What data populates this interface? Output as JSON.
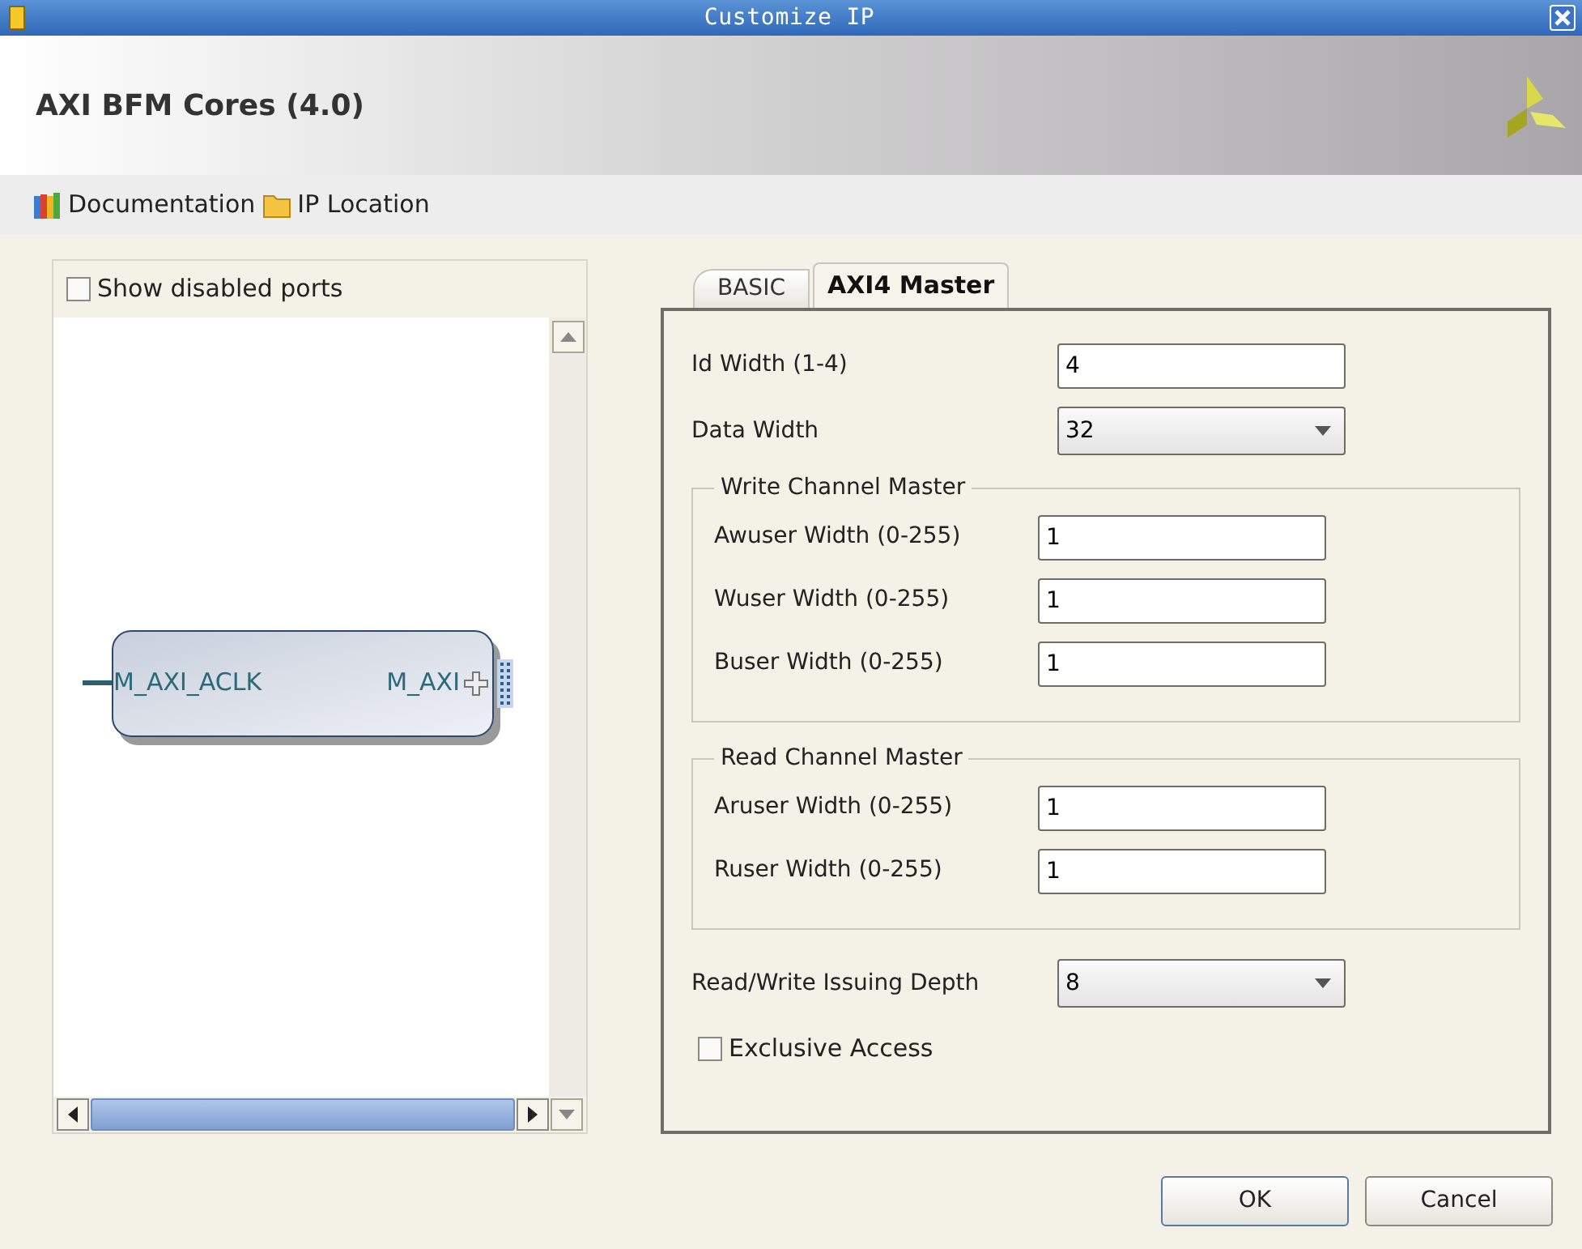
{
  "window": {
    "title": "Customize IP"
  },
  "header": {
    "title": "AXI BFM Cores (4.0)"
  },
  "toolbar": [
    {
      "kind": "books",
      "label": "Documentation"
    },
    {
      "kind": "folder",
      "label": "IP Location"
    }
  ],
  "ports_panel": {
    "show_disabled": {
      "label": "Show disabled ports",
      "checked": false
    },
    "block": {
      "left_port": "M_AXI_ACLK",
      "right_port": "M_AXI"
    }
  },
  "tabs": [
    {
      "label": "BASIC",
      "selected": false
    },
    {
      "label": "AXI4 Master",
      "selected": true
    }
  ],
  "fields": [
    {
      "kind": "text",
      "label": "Id Width (1-4)",
      "value": "4"
    },
    {
      "kind": "dropdown",
      "label": "Data Width",
      "value": "32"
    },
    {
      "kind": "group",
      "title": "Write Channel Master",
      "fields": [
        {
          "kind": "text",
          "label": "Awuser Width (0-255)",
          "value": "1"
        },
        {
          "kind": "text",
          "label": "Wuser Width (0-255)",
          "value": "1"
        },
        {
          "kind": "text",
          "label": "Buser Width (0-255)",
          "value": "1"
        }
      ]
    },
    {
      "kind": "group",
      "title": "Read Channel Master",
      "fields": [
        {
          "kind": "text",
          "label": "Aruser Width (0-255)",
          "value": "1"
        },
        {
          "kind": "text",
          "label": "Ruser Width (0-255)",
          "value": "1"
        }
      ]
    },
    {
      "kind": "dropdown",
      "label": "Read/Write Issuing Depth",
      "value": "8"
    },
    {
      "kind": "checkbox",
      "label": "Exclusive Access",
      "checked": false
    }
  ],
  "buttons": [
    {
      "label": "OK",
      "default": true
    },
    {
      "label": "Cancel",
      "default": false
    }
  ]
}
